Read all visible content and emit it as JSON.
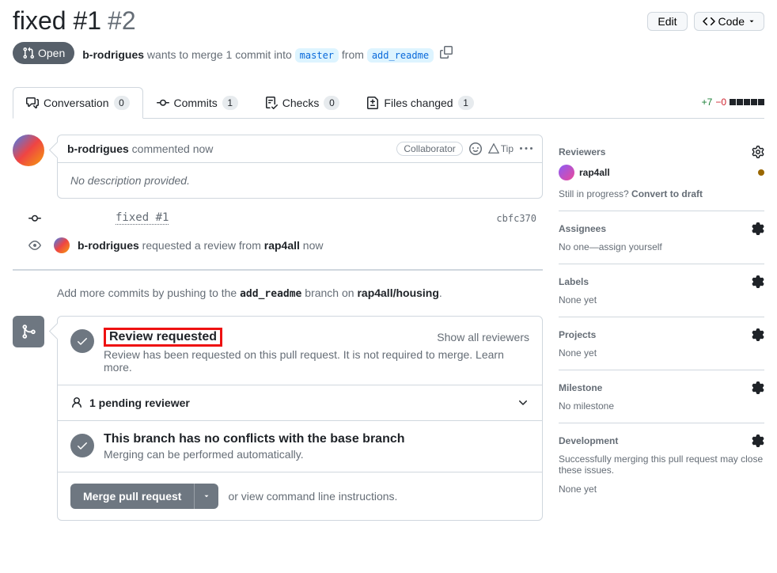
{
  "header": {
    "title": "fixed #1",
    "number": "#2",
    "edit": "Edit",
    "code": "Code"
  },
  "state": {
    "label": "Open"
  },
  "meta": {
    "author": "b-rodrigues",
    "wants_text": " wants to merge 1 commit into ",
    "base": "master",
    "from_text": " from ",
    "head": "add_readme"
  },
  "tabs": {
    "conversation": {
      "label": "Conversation",
      "count": "0"
    },
    "commits": {
      "label": "Commits",
      "count": "1"
    },
    "checks": {
      "label": "Checks",
      "count": "0"
    },
    "files": {
      "label": "Files changed",
      "count": "1"
    }
  },
  "diffstat": {
    "add": "+7",
    "del": "−0"
  },
  "comment": {
    "author": "b-rodrigues",
    "action": " commented ",
    "time": "now",
    "role": "Collaborator",
    "tip": "Tip",
    "body": "No description provided."
  },
  "commit": {
    "message": "fixed #1",
    "sha": "cbfc370"
  },
  "review_event": {
    "author": "b-rodrigues",
    "text": " requested a review from ",
    "target": "rap4all",
    "time": " now"
  },
  "push_hint": {
    "pre": "Add more commits by pushing to the ",
    "branch": "add_readme",
    "mid": " branch on ",
    "repo": "rap4all/housing",
    "post": "."
  },
  "merge": {
    "review_requested": "Review requested",
    "review_body": "Review has been requested on this pull request. It is not required to merge. ",
    "learn_more": "Learn more.",
    "show_all": "Show all reviewers",
    "pending": "1 pending reviewer",
    "no_conflicts_title": "This branch has no conflicts with the base branch",
    "no_conflicts_body": "Merging can be performed automatically.",
    "merge_btn": "Merge pull request",
    "or_view_pre": "or view ",
    "or_view_link": "command line instructions."
  },
  "sidebar": {
    "reviewers": {
      "title": "Reviewers",
      "name": "rap4all",
      "draft_pre": "Still in progress? ",
      "draft_link": "Convert to draft"
    },
    "assignees": {
      "title": "Assignees",
      "body_pre": "No one—",
      "body_link": "assign yourself"
    },
    "labels": {
      "title": "Labels",
      "body": "None yet"
    },
    "projects": {
      "title": "Projects",
      "body": "None yet"
    },
    "milestone": {
      "title": "Milestone",
      "body": "No milestone"
    },
    "development": {
      "title": "Development",
      "body": "Successfully merging this pull request may close these issues.",
      "none": "None yet"
    }
  }
}
